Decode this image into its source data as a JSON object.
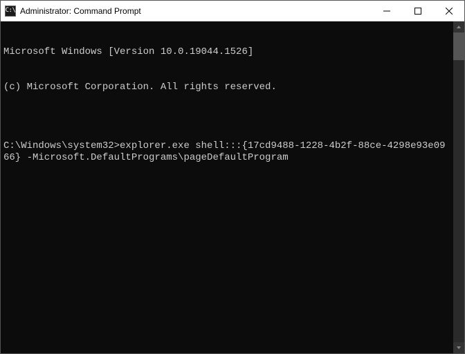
{
  "titlebar": {
    "icon_name": "cmd-icon",
    "icon_text": "C:\\",
    "title": "Administrator: Command Prompt"
  },
  "terminal": {
    "lines": [
      "Microsoft Windows [Version 10.0.19044.1526]",
      "(c) Microsoft Corporation. All rights reserved.",
      "",
      "C:\\Windows\\system32>explorer.exe shell:::{17cd9488-1228-4b2f-88ce-4298e93e0966} -Microsoft.DefaultPrograms\\pageDefaultProgram"
    ]
  }
}
